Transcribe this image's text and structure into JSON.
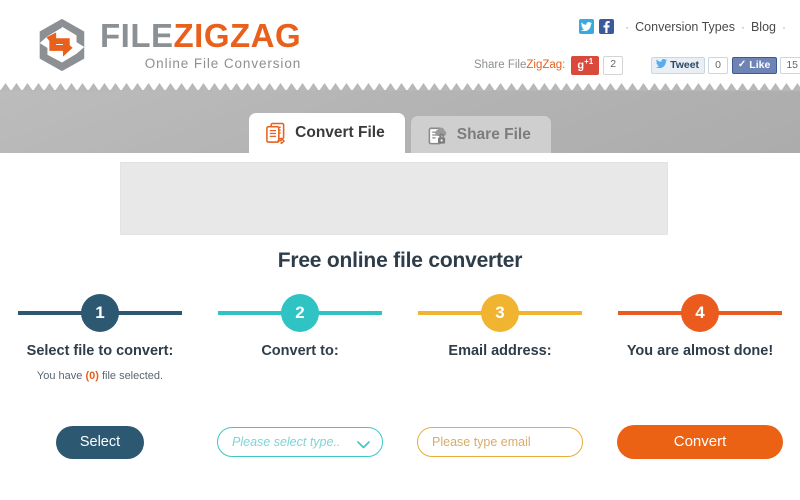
{
  "header": {
    "logo": {
      "icon": "zigzag-hexagon-logo",
      "title_part1": "FILE",
      "title_part2": "ZIGZAG",
      "tagline": "Online File Conversion"
    },
    "nav": {
      "twitter_icon": "twitter-icon",
      "facebook_icon": "facebook-icon",
      "sep1": "·",
      "link_conversion_types": "Conversion Types",
      "sep2": "·",
      "link_blog": "Blog",
      "sep3": "·"
    },
    "share": {
      "label_prefix": "Share ",
      "label_file": "File",
      "label_zigzag": "ZigZag",
      "label_colon": ":",
      "gplus_label": "g",
      "gplus_sup": "+1",
      "gplus_count": "2",
      "tweet_label": "Tweet",
      "tweet_count": "0",
      "like_label": "Like",
      "like_count": "15"
    }
  },
  "tabs": [
    {
      "label": "Convert File",
      "icon": "convert-file-icon",
      "active": true
    },
    {
      "label": "Share File",
      "icon": "share-file-lock-icon",
      "active": false
    }
  ],
  "main": {
    "ad_placeholder": "",
    "page_title": "Free online file converter"
  },
  "steps": [
    {
      "number": "1",
      "label": "Select file to convert:",
      "color": "#2c5872",
      "note_before": "You have ",
      "note_count": "(0)",
      "note_after": " file selected.",
      "button_label": "Select"
    },
    {
      "number": "2",
      "label": "Convert to:",
      "color": "#2fc3c3",
      "select_placeholder": "Please select type..",
      "select_options": [
        "Please select type.."
      ],
      "chevron_icon": "chevron-down-icon"
    },
    {
      "number": "3",
      "label": "Email address:",
      "color": "#f0b431",
      "input_placeholder": "Please type email",
      "input_value": ""
    },
    {
      "number": "4",
      "label": "You are almost done!",
      "color": "#ec5b1e",
      "button_label": "Convert"
    }
  ],
  "colors": {
    "brand_orange": "#e8601c",
    "step1": "#2c5872",
    "step2": "#2fc3c3",
    "step3": "#f0b431",
    "step4": "#ec5b1e",
    "band_gray": "#b4b4b4"
  }
}
